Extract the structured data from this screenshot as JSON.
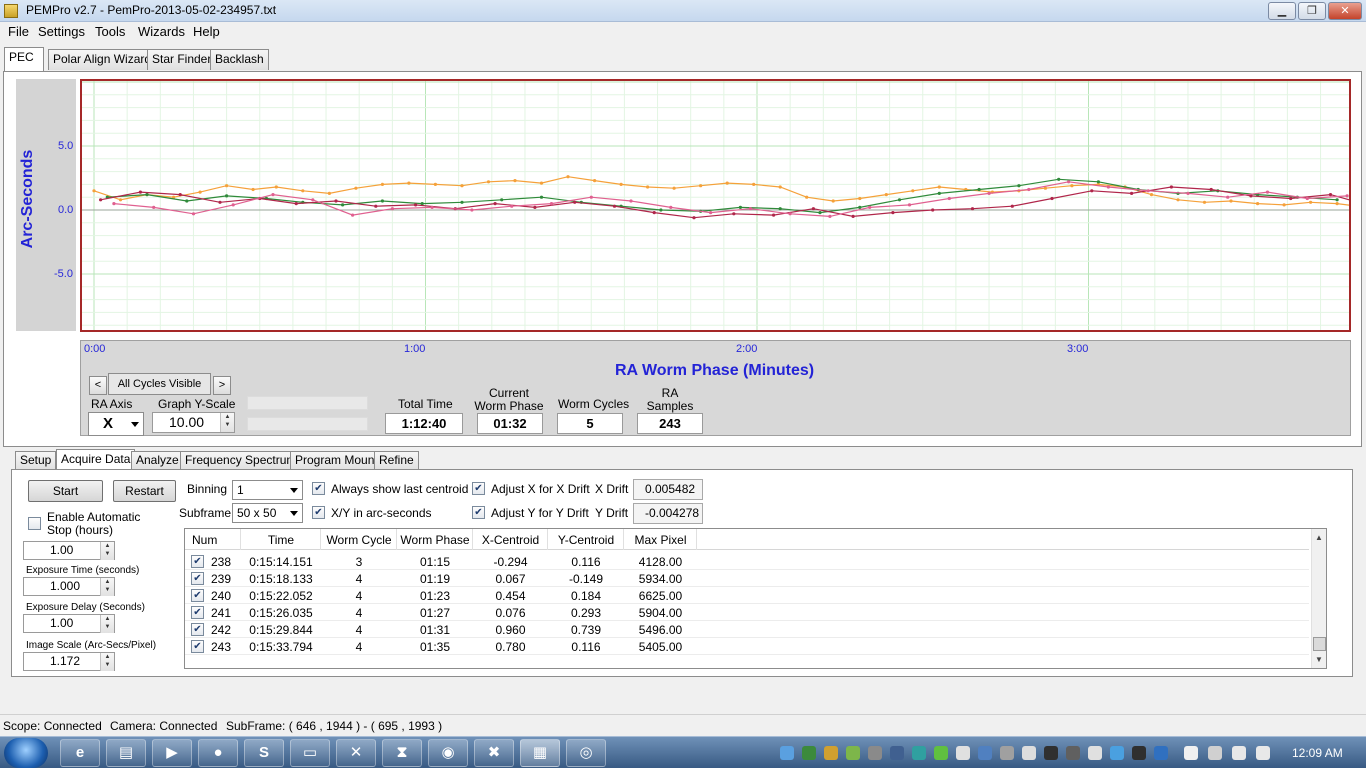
{
  "window": {
    "title": "PEMPro v2.7 - PemPro-2013-05-02-234957.txt",
    "min": "▁",
    "max": "❐",
    "close": "✕"
  },
  "menu": [
    "File",
    "Settings",
    "Tools",
    "Wizards",
    "Help"
  ],
  "main_tabs": [
    "PEC",
    "Polar Align Wizard",
    "Star Finder",
    "Backlash"
  ],
  "chart_data": {
    "type": "line",
    "ylabel": "Arc-Seconds",
    "xlabel": "RA Worm Phase (Minutes)",
    "y_ticks": [
      "5.0",
      "0.0",
      "-5.0"
    ],
    "x_ticks": [
      "0:00",
      "1:00",
      "2:00",
      "3:00"
    ],
    "ylim": [
      -10,
      10
    ],
    "xlim_minutes": [
      0,
      3.81
    ],
    "grid": true,
    "series": [
      {
        "color": "#f5a13a",
        "x": [
          0.0,
          0.08,
          0.16,
          0.24,
          0.32,
          0.4,
          0.48,
          0.55,
          0.63,
          0.71,
          0.79,
          0.87,
          0.95,
          1.03,
          1.11,
          1.19,
          1.27,
          1.35,
          1.43,
          1.51,
          1.59,
          1.67,
          1.75,
          1.83,
          1.91,
          1.99,
          2.07,
          2.15,
          2.23,
          2.31,
          2.39,
          2.47,
          2.55,
          2.63,
          2.71,
          2.79,
          2.87,
          2.95,
          3.03,
          3.11,
          3.19,
          3.27,
          3.35,
          3.43,
          3.51,
          3.59,
          3.67,
          3.75,
          3.81
        ],
        "y": [
          1.5,
          0.8,
          1.2,
          1.0,
          1.4,
          1.9,
          1.6,
          1.8,
          1.5,
          1.3,
          1.7,
          2.0,
          2.1,
          2.0,
          1.9,
          2.2,
          2.3,
          2.1,
          2.6,
          2.3,
          2.0,
          1.8,
          1.7,
          1.9,
          2.1,
          2.0,
          1.8,
          1.0,
          0.7,
          0.9,
          1.2,
          1.5,
          1.8,
          1.6,
          1.4,
          1.5,
          1.7,
          1.9,
          2.0,
          1.8,
          1.2,
          0.8,
          0.6,
          0.7,
          0.5,
          0.4,
          0.6,
          0.5,
          0.3
        ]
      },
      {
        "color": "#2f8a3a",
        "x": [
          0.04,
          0.16,
          0.28,
          0.4,
          0.52,
          0.63,
          0.75,
          0.87,
          0.99,
          1.11,
          1.23,
          1.35,
          1.47,
          1.59,
          1.71,
          1.83,
          1.95,
          2.07,
          2.19,
          2.31,
          2.43,
          2.55,
          2.67,
          2.79,
          2.91,
          3.03,
          3.15,
          3.27,
          3.39,
          3.51,
          3.63,
          3.75
        ],
        "y": [
          1.0,
          1.2,
          0.7,
          1.1,
          0.9,
          0.6,
          0.4,
          0.7,
          0.5,
          0.6,
          0.8,
          1.0,
          0.6,
          0.3,
          0.0,
          -0.1,
          0.2,
          0.1,
          -0.2,
          0.2,
          0.8,
          1.3,
          1.6,
          1.9,
          2.4,
          2.2,
          1.6,
          1.3,
          1.5,
          1.2,
          1.0,
          0.8
        ]
      },
      {
        "color": "#b0264a",
        "x": [
          0.02,
          0.14,
          0.26,
          0.38,
          0.5,
          0.61,
          0.73,
          0.85,
          0.97,
          1.09,
          1.21,
          1.33,
          1.45,
          1.57,
          1.69,
          1.81,
          1.93,
          2.05,
          2.17,
          2.29,
          2.41,
          2.53,
          2.65,
          2.77,
          2.89,
          3.01,
          3.13,
          3.25,
          3.37,
          3.49,
          3.61,
          3.73,
          3.8
        ],
        "y": [
          0.8,
          1.4,
          1.2,
          0.6,
          0.9,
          0.5,
          0.7,
          0.3,
          0.4,
          0.1,
          0.5,
          0.2,
          0.6,
          0.3,
          -0.2,
          -0.6,
          -0.3,
          -0.4,
          0.1,
          -0.5,
          -0.2,
          0.0,
          0.1,
          0.3,
          0.9,
          1.5,
          1.3,
          1.8,
          1.6,
          1.1,
          0.9,
          1.2,
          0.7
        ]
      },
      {
        "color": "#e06090",
        "x": [
          0.06,
          0.18,
          0.3,
          0.42,
          0.54,
          0.66,
          0.78,
          0.9,
          1.02,
          1.14,
          1.26,
          1.38,
          1.5,
          1.62,
          1.74,
          1.86,
          1.98,
          2.1,
          2.22,
          2.34,
          2.46,
          2.58,
          2.7,
          2.82,
          2.94,
          3.06,
          3.18,
          3.3,
          3.42,
          3.54,
          3.66,
          3.78
        ],
        "y": [
          0.5,
          0.2,
          -0.3,
          0.4,
          1.2,
          0.8,
          -0.4,
          0.1,
          0.2,
          0.0,
          0.3,
          0.5,
          1.0,
          0.7,
          0.2,
          -0.2,
          0.1,
          -0.3,
          -0.5,
          0.2,
          0.4,
          0.9,
          1.3,
          1.6,
          2.2,
          1.8,
          1.5,
          1.3,
          1.0,
          1.4,
          0.9,
          1.1
        ]
      }
    ]
  },
  "controls": {
    "prev": "<",
    "next": ">",
    "cycles_label": "All Cycles Visible",
    "ra_axis_label": "RA Axis",
    "ra_axis_value": "X",
    "y_scale_label": "Graph Y-Scale",
    "y_scale_value": "10.00",
    "total_time_label": "Total Time",
    "total_time": "1:12:40",
    "worm_phase_label": "Current Worm Phase",
    "worm_phase": "01:32",
    "worm_cycles_label": "Worm Cycles",
    "worm_cycles": "5",
    "ra_samples_label": "RA Samples",
    "ra_samples": "243"
  },
  "sub_tabs": [
    "Setup",
    "Acquire Data",
    "Analyze",
    "Frequency Spectrum",
    "Program Mount",
    "Refine"
  ],
  "acquire": {
    "start": "Start",
    "restart": "Restart",
    "binning_label": "Binning",
    "binning": "1",
    "subframe_label": "Subframe",
    "subframe": "50 x 50",
    "always_show": "Always show last centroid",
    "xy_arcsec": "X/Y in arc-seconds",
    "adjust_x": "Adjust X for X Drift",
    "adjust_y": "Adjust Y for Y Drift",
    "x_drift_label": "X Drift",
    "x_drift": "0.005482",
    "y_drift_label": "Y Drift",
    "y_drift": "-0.004278",
    "enable_auto": "Enable Automatic Stop (hours)",
    "auto_hours": "1.00",
    "exposure_time_label": "Exposure Time (seconds)",
    "exposure_time": "1.000",
    "exposure_delay_label": "Exposure Delay (Seconds)",
    "exposure_delay": "1.00",
    "image_scale_label": "Image Scale (Arc-Secs/Pixel)",
    "image_scale": "1.172"
  },
  "table": {
    "headers": [
      "Num",
      "Time",
      "Worm Cycle",
      "Worm Phase",
      "X-Centroid",
      "Y-Centroid",
      "Max Pixel"
    ],
    "rows": [
      [
        "238",
        "0:15:14.151",
        "3",
        "01:15",
        "-0.294",
        "0.116",
        "4128.00"
      ],
      [
        "239",
        "0:15:18.133",
        "4",
        "01:19",
        "0.067",
        "-0.149",
        "5934.00"
      ],
      [
        "240",
        "0:15:22.052",
        "4",
        "01:23",
        "0.454",
        "0.184",
        "6625.00"
      ],
      [
        "241",
        "0:15:26.035",
        "4",
        "01:27",
        "0.076",
        "0.293",
        "5904.00"
      ],
      [
        "242",
        "0:15:29.844",
        "4",
        "01:31",
        "0.960",
        "0.739",
        "5496.00"
      ],
      [
        "243",
        "0:15:33.794",
        "4",
        "01:35",
        "0.780",
        "0.116",
        "5405.00"
      ]
    ]
  },
  "status": {
    "scope": "Scope: Connected",
    "camera": "Camera: Connected",
    "subframe": "SubFrame: ( 646 , 1944 ) - ( 695 , 1993 )"
  },
  "taskbar": {
    "clock": "12:09 AM"
  }
}
